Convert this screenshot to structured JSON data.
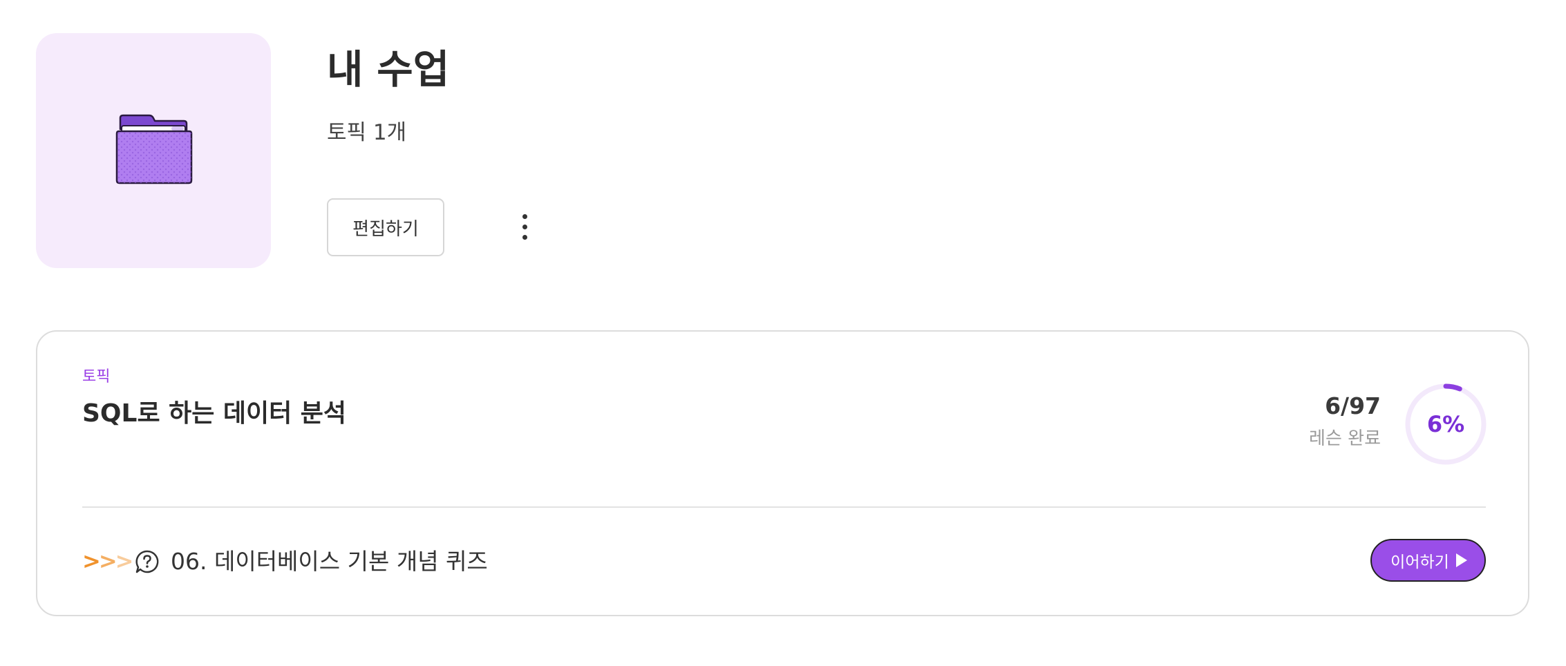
{
  "header": {
    "title": "내 수업",
    "topic_count": "토픽 1개",
    "edit_label": "편집하기",
    "cover_icon": "folder-icon",
    "more_icon": "more-vertical-icon"
  },
  "topic_card": {
    "kicker": "토픽",
    "title": "SQL로 하는 데이터 분석",
    "progress_count": "6/97",
    "progress_label": "레슨 완료",
    "progress_percent_text": "6%",
    "progress_fraction": 0.06,
    "current_lesson": {
      "indicator": ">>>",
      "icon": "question-icon",
      "title": "06. 데이터베이스 기본 개념 퀴즈"
    },
    "continue_label": "이어하기"
  },
  "colors": {
    "accent": "#9a4ee8",
    "accent_dark": "#7a2fd6",
    "cover_bg": "#f6ebfc",
    "ring_track": "#f3e9fb",
    "indicator_orange": "#f0922c"
  }
}
